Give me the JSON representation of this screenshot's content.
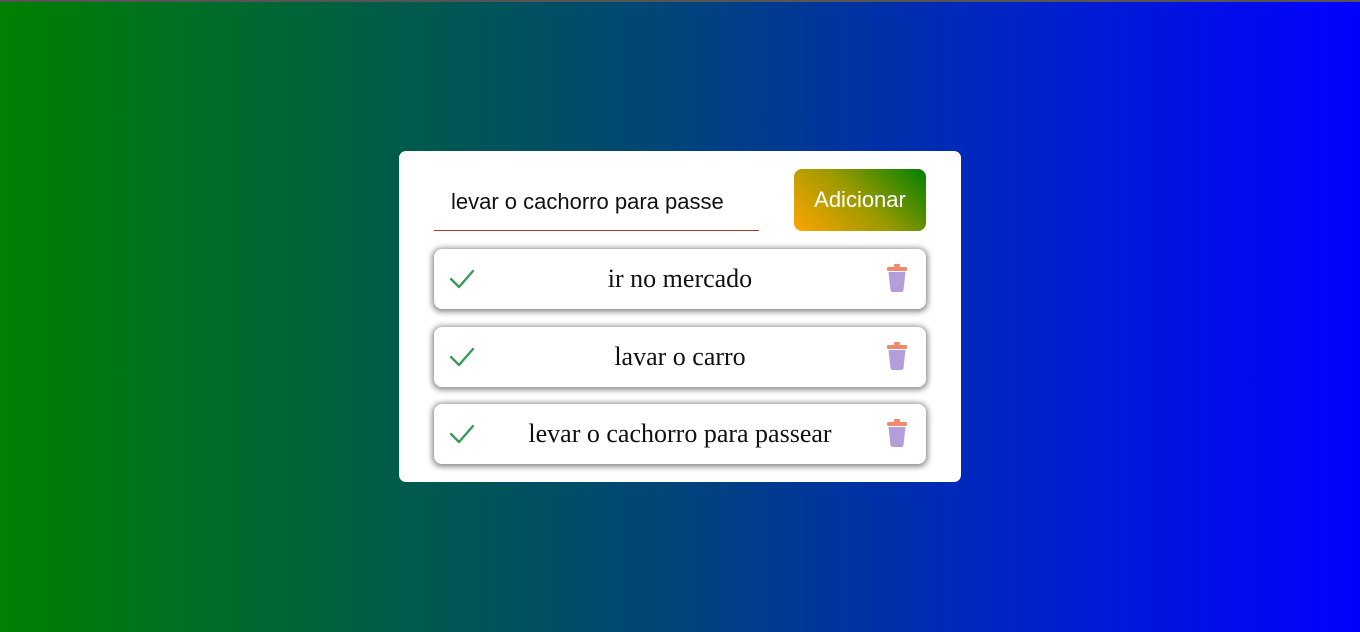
{
  "new_task": {
    "value": "levar o cachorro para passe",
    "button_label": "Adicionar"
  },
  "todos": [
    {
      "text": "ir no mercado"
    },
    {
      "text": "lavar o carro"
    },
    {
      "text": "levar o cachorro para passear"
    }
  ],
  "icons": {
    "check": "check-icon",
    "trash": "trash-icon"
  },
  "colors": {
    "background_start": "#008000",
    "background_end": "#0000ff",
    "button_start": "#ffa500",
    "button_end": "#008000",
    "check": "#3a9a5a",
    "trash": "#b39ddb",
    "trash_lid": "#f08a6a"
  }
}
